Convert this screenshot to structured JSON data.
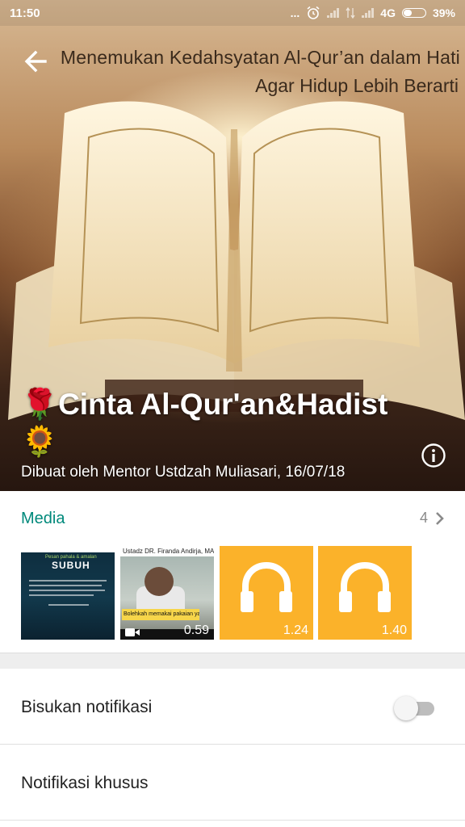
{
  "status_bar": {
    "time": "11:50",
    "dots": "...",
    "network": "4G",
    "battery_percent": "39%",
    "battery_level": 0.39
  },
  "header": {
    "banner_line1": "Menemukan Kedahsyatan Al-Qur’an dalam Hati",
    "banner_line2": "Agar Hidup Lebih Berarti",
    "group_title": "🌹Cinta Al-Qur'an&Hadist🌻",
    "subtitle": "Dibuat oleh Mentor Ustdzah Muliasari, 16/07/18",
    "back_icon": "arrow-left-icon",
    "info_icon": "info-icon"
  },
  "media": {
    "label": "Media",
    "count": "4",
    "items": [
      {
        "type": "image",
        "title": "SUBUH",
        "caption": "Pesan pahala & amalan"
      },
      {
        "type": "video",
        "top_text": "Ustadz DR. Firanda Andirja, MA",
        "caption": "Bolehkah memakai pakaian yang berwarna warni?",
        "duration": "0.59"
      },
      {
        "type": "audio",
        "icon": "headphones-icon",
        "duration": "1.24"
      },
      {
        "type": "audio",
        "icon": "headphones-icon",
        "duration": "1.40"
      }
    ]
  },
  "settings": {
    "mute_label": "Bisukan notifikasi",
    "mute_enabled": false,
    "custom_label": "Notifikasi khusus"
  },
  "colors": {
    "accent": "#00897b",
    "audio_tile": "#fbb22a"
  }
}
